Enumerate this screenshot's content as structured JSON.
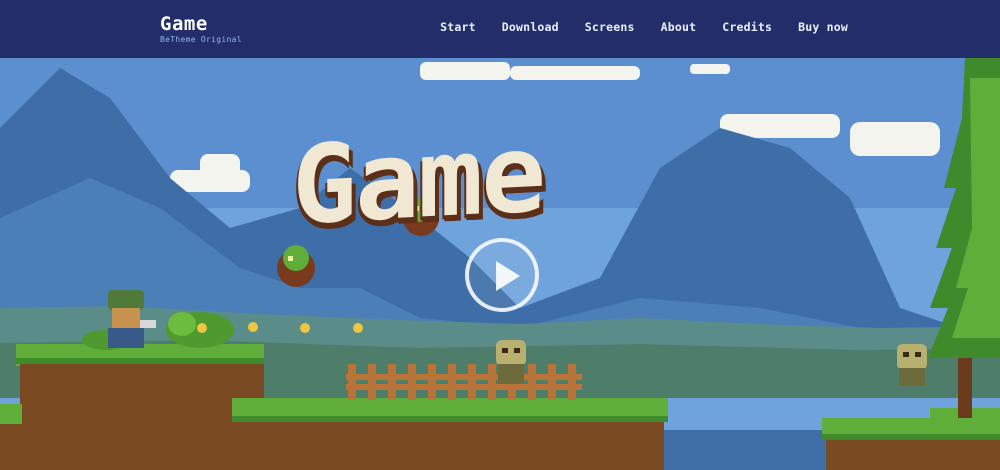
{
  "brand": {
    "title": "Game",
    "subtitle": "BeTheme Original"
  },
  "nav": {
    "items": [
      {
        "label": "Start"
      },
      {
        "label": "Download"
      },
      {
        "label": "Screens"
      },
      {
        "label": "About"
      },
      {
        "label": "Credits"
      },
      {
        "label": "Buy now"
      }
    ]
  },
  "hero": {
    "title": "Game",
    "play_icon": "play-icon"
  },
  "colors": {
    "header_bg": "#222d6a",
    "sky": "#4f86c8",
    "grass": "#5fae3a",
    "dirt": "#7a4a22",
    "title_text": "#f1e8d4"
  }
}
